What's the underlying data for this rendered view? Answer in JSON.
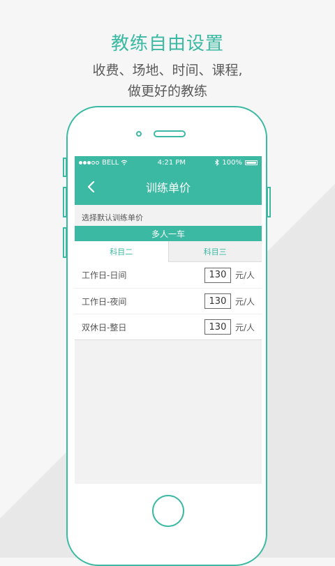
{
  "headline": {
    "title": "教练自由设置",
    "line1": "收费、场地、时间、课程,",
    "line2": "做更好的教练"
  },
  "status_bar": {
    "carrier": "BELL",
    "time": "4:21 PM",
    "battery": "100%"
  },
  "navbar": {
    "title": "训练单价"
  },
  "hint": "选择默认训练单价",
  "section_title": "多人一车",
  "tabs": [
    {
      "label": "科目二",
      "active": true
    },
    {
      "label": "科目三",
      "active": false
    }
  ],
  "rows": [
    {
      "label": "工作日-日间",
      "price": "130",
      "unit": "元/人"
    },
    {
      "label": "工作日-夜间",
      "price": "130",
      "unit": "元/人"
    },
    {
      "label": "双休日-整日",
      "price": "130",
      "unit": "元/人"
    }
  ],
  "colors": {
    "accent": "#3bb9a2",
    "background": "#f6f6f6"
  }
}
